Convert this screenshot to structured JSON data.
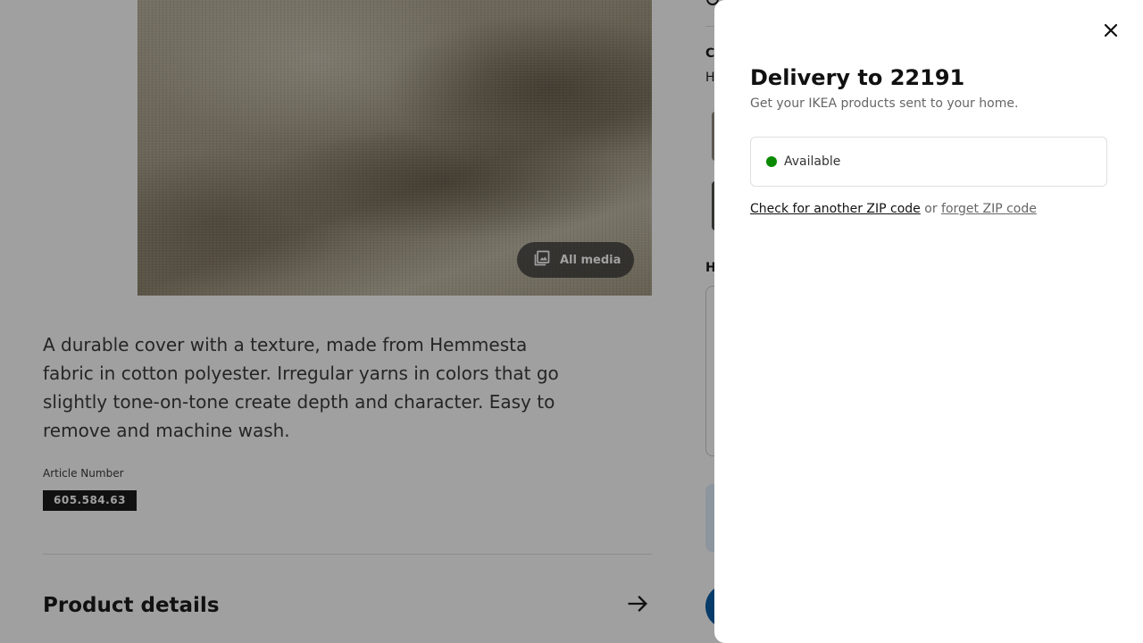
{
  "product": {
    "all_media_label": "All media",
    "description": "A durable cover with a texture, made from Hemmesta fabric in cotton polyester. Irregular yarns in colors that go slightly tone-on-tone create depth and character. Easy to remove and machine wash.",
    "article_label": "Article Number",
    "article_number": "605.584.63",
    "details_title": "Product details"
  },
  "right_column": {
    "letter_1": "C",
    "letter_2": "H",
    "letter_3": "H"
  },
  "modal": {
    "title": "Delivery to 22191",
    "subtitle": "Get your IKEA products sent to your home.",
    "status": "Available",
    "status_color": "#0a8a00",
    "check_link": "Check for another ZIP code",
    "or_text": "or",
    "forget_link": "forget ZIP code"
  }
}
